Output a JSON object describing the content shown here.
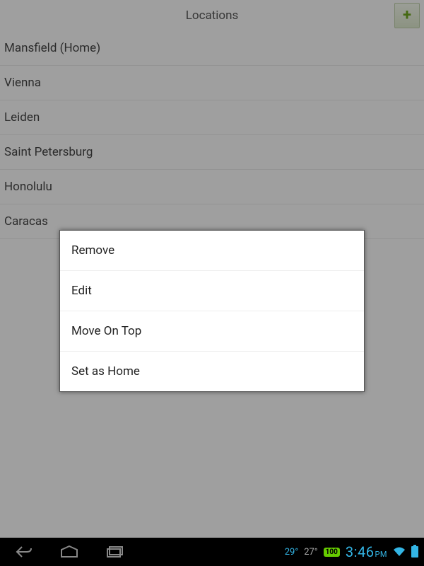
{
  "header": {
    "title": "Locations"
  },
  "list": {
    "items": [
      {
        "label": "Mansfield (Home)"
      },
      {
        "label": "Vienna"
      },
      {
        "label": "Leiden"
      },
      {
        "label": "Saint Petersburg"
      },
      {
        "label": "Honolulu"
      },
      {
        "label": "Caracas"
      }
    ]
  },
  "context_menu": {
    "items": [
      {
        "label": "Remove"
      },
      {
        "label": "Edit"
      },
      {
        "label": "Move On Top"
      },
      {
        "label": "Set as Home"
      }
    ]
  },
  "statusbar": {
    "temp_hi": "29°",
    "temp_lo": "27°",
    "battery_label": "100",
    "time": "3:46",
    "ampm": "PM"
  }
}
